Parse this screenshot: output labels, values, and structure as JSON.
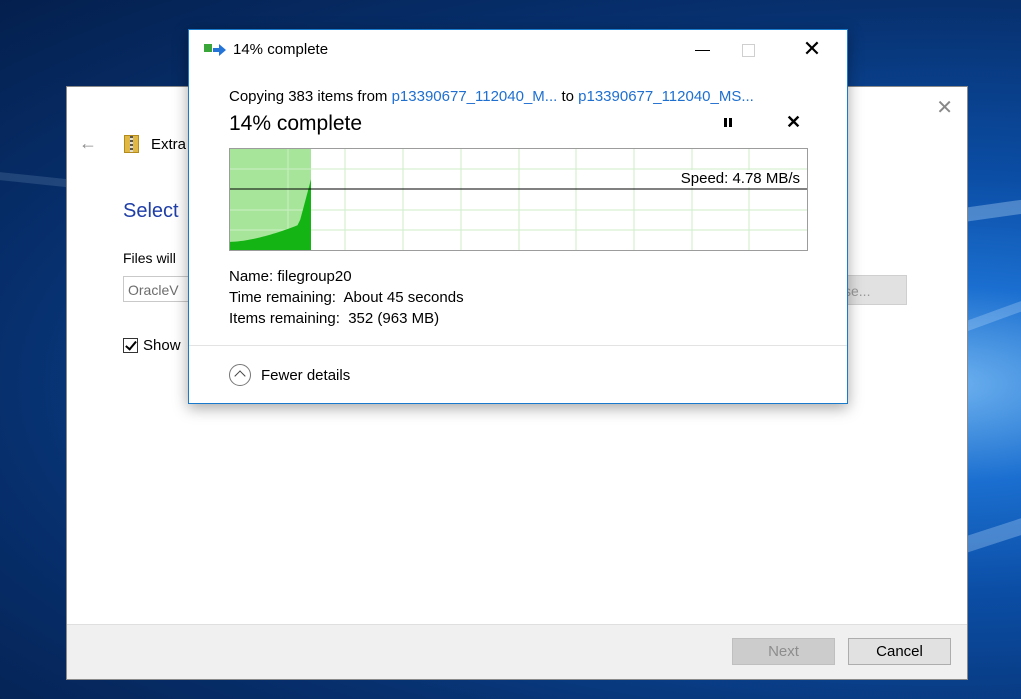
{
  "copy_dialog": {
    "title": "14% complete",
    "copying_prefix": "Copying 383 items from ",
    "source": "p13390677_112040_M...",
    "to_word": " to ",
    "destination": "p13390677_112040_MS...",
    "percent_text": "14% complete",
    "progress_fraction": 0.14,
    "speed": "Speed: 4.78 MB/s",
    "name_label": "Name:",
    "name_value": "filegroup20",
    "time_label": "Time remaining:",
    "time_value": "About 45 seconds",
    "items_label": "Items remaining:",
    "items_value": "352 (963 MB)",
    "fewer_details": "Fewer details",
    "colors": {
      "progress_fill": "#a6e59a",
      "speed_fill": "#14b414",
      "accent": "#1e6fd0"
    }
  },
  "wizard": {
    "title_partial": "Extra",
    "heading_partial": "Select",
    "files_label_partial": "Files will",
    "path_partial": "OracleV",
    "browse_partial": "se...",
    "show_partial": "Show",
    "next_label": "Next",
    "cancel_label": "Cancel"
  }
}
